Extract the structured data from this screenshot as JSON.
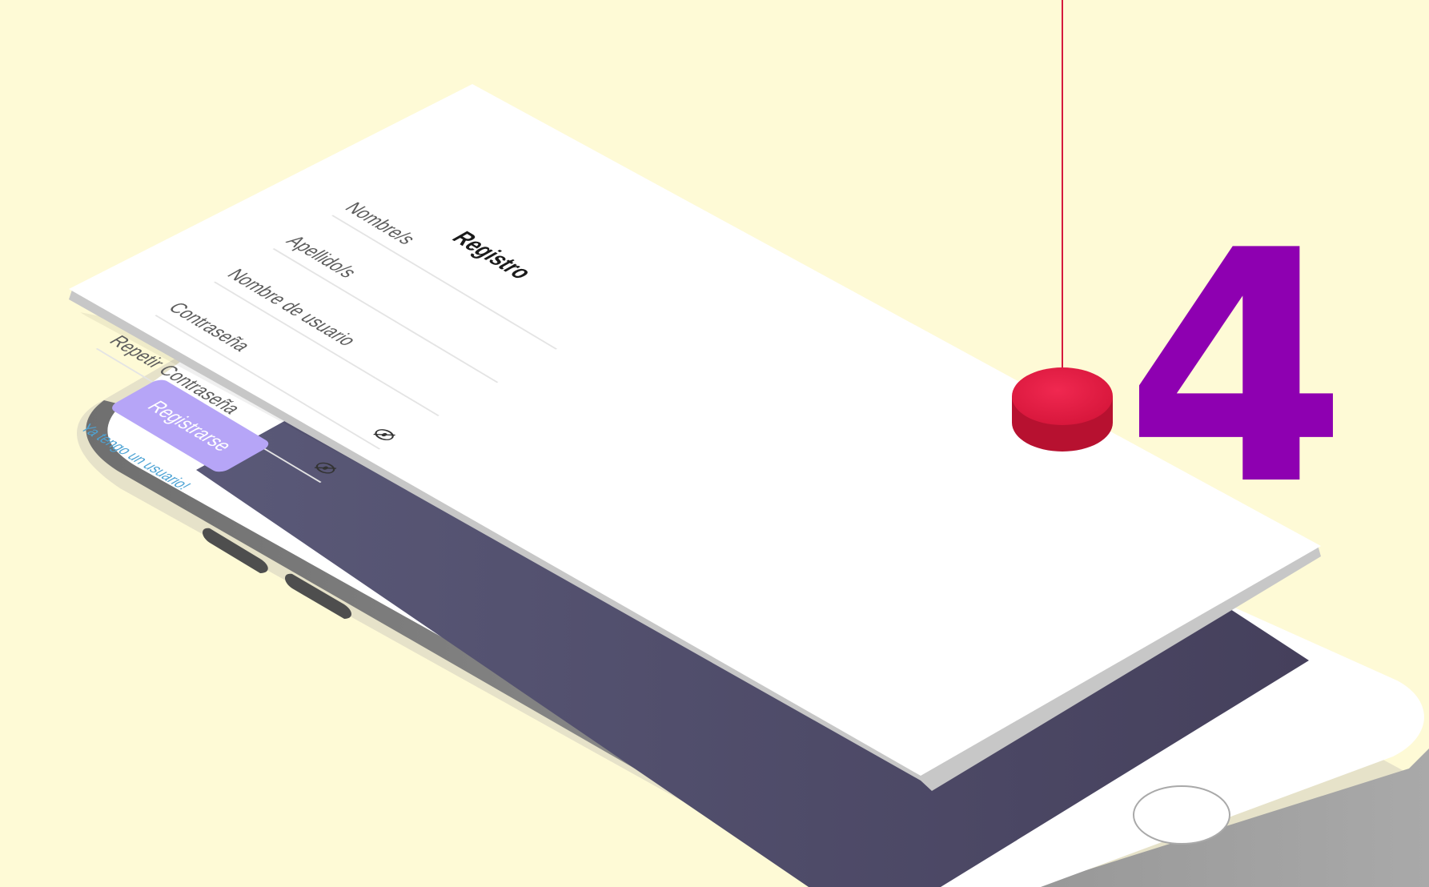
{
  "form": {
    "title": "Registro",
    "fields": [
      {
        "placeholder": "Nombre/s",
        "icon": null
      },
      {
        "placeholder": "Apellido/s",
        "icon": null
      },
      {
        "placeholder": "Nombre de usuario",
        "icon": null
      },
      {
        "placeholder": "Contraseña",
        "icon": "eye-off-icon"
      },
      {
        "placeholder": "Repetir Contraseña",
        "icon": "eye-off-icon"
      }
    ],
    "register_label": "Registrarse",
    "login_link": "Ya tengo un usuario!"
  },
  "step_number": "4",
  "colors": {
    "background": "#fefad6",
    "accent_number": "#8e00b1",
    "marker": "#e21c43",
    "button": "#b6a5f7",
    "link": "#4da3d4",
    "phone_screen": "#565677"
  }
}
